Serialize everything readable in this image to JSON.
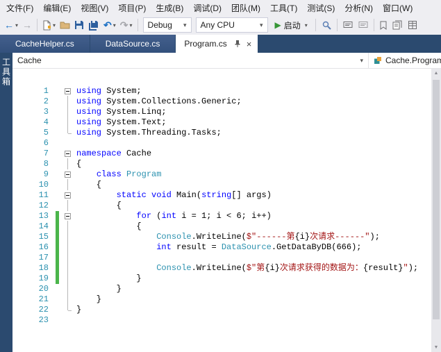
{
  "menu": {
    "items": [
      "文件(F)",
      "编辑(E)",
      "视图(V)",
      "项目(P)",
      "生成(B)",
      "调试(D)",
      "团队(M)",
      "工具(T)",
      "测试(S)",
      "分析(N)",
      "窗口(W)"
    ]
  },
  "toolbar": {
    "solution_config": "Debug",
    "platform": "Any CPU",
    "start_label": "启动"
  },
  "icons": {
    "back": "←",
    "forward": "→",
    "undo": "↶",
    "redo": "↷",
    "caret": "▾",
    "play": "▶",
    "close": "×",
    "scroll_up": "▲",
    "scroll_down": "▼"
  },
  "tabs": [
    {
      "label": "CacheHelper.cs",
      "active": false
    },
    {
      "label": "DataSource.cs",
      "active": false
    },
    {
      "label": "Program.cs",
      "active": true
    }
  ],
  "toolbox": {
    "label": "工具箱"
  },
  "breadcrumb": {
    "project": "Cache",
    "member": "Cache.Program"
  },
  "editor": {
    "language": "csharp",
    "lines": [
      {
        "n": 1,
        "fold": "minus",
        "changed": false,
        "tokens": [
          [
            "k",
            "using"
          ],
          [
            "p",
            " System;"
          ]
        ]
      },
      {
        "n": 2,
        "fold": "line",
        "changed": false,
        "tokens": [
          [
            "k",
            "using"
          ],
          [
            "p",
            " System.Collections.Generic;"
          ]
        ]
      },
      {
        "n": 3,
        "fold": "line",
        "changed": false,
        "tokens": [
          [
            "k",
            "using"
          ],
          [
            "p",
            " System.Linq;"
          ]
        ]
      },
      {
        "n": 4,
        "fold": "line",
        "changed": false,
        "tokens": [
          [
            "k",
            "using"
          ],
          [
            "p",
            " System.Text;"
          ]
        ]
      },
      {
        "n": 5,
        "fold": "end",
        "changed": false,
        "tokens": [
          [
            "k",
            "using"
          ],
          [
            "p",
            " System.Threading.Tasks;"
          ]
        ]
      },
      {
        "n": 6,
        "fold": "",
        "changed": false,
        "tokens": []
      },
      {
        "n": 7,
        "fold": "minus",
        "changed": false,
        "tokens": [
          [
            "k",
            "namespace"
          ],
          [
            "p",
            " Cache"
          ]
        ]
      },
      {
        "n": 8,
        "fold": "line",
        "changed": false,
        "tokens": [
          [
            "p",
            "{"
          ]
        ]
      },
      {
        "n": 9,
        "fold": "minus",
        "changed": false,
        "tokens": [
          [
            "p",
            "    "
          ],
          [
            "k",
            "class"
          ],
          [
            "p",
            " "
          ],
          [
            "t",
            "Program"
          ]
        ]
      },
      {
        "n": 10,
        "fold": "line",
        "changed": false,
        "tokens": [
          [
            "p",
            "    {"
          ]
        ]
      },
      {
        "n": 11,
        "fold": "minus",
        "changed": false,
        "tokens": [
          [
            "p",
            "        "
          ],
          [
            "k",
            "static"
          ],
          [
            "p",
            " "
          ],
          [
            "k",
            "void"
          ],
          [
            "p",
            " Main("
          ],
          [
            "k",
            "string"
          ],
          [
            "p",
            "[] args)"
          ]
        ]
      },
      {
        "n": 12,
        "fold": "line",
        "changed": false,
        "tokens": [
          [
            "p",
            "        {"
          ]
        ]
      },
      {
        "n": 13,
        "fold": "minus",
        "changed": true,
        "tokens": [
          [
            "p",
            "            "
          ],
          [
            "k",
            "for"
          ],
          [
            "p",
            " ("
          ],
          [
            "k",
            "int"
          ],
          [
            "p",
            " i = 1; i < 6; i++)"
          ]
        ]
      },
      {
        "n": 14,
        "fold": "line",
        "changed": true,
        "tokens": [
          [
            "p",
            "            {"
          ]
        ]
      },
      {
        "n": 15,
        "fold": "line",
        "changed": true,
        "tokens": [
          [
            "p",
            "                "
          ],
          [
            "t",
            "Console"
          ],
          [
            "p",
            ".WriteLine("
          ],
          [
            "s",
            "$\"------第"
          ],
          [
            "p",
            "{i}"
          ],
          [
            "s",
            "次请求------\""
          ],
          [
            "p",
            ");"
          ]
        ]
      },
      {
        "n": 16,
        "fold": "line",
        "changed": true,
        "tokens": [
          [
            "p",
            "                "
          ],
          [
            "k",
            "int"
          ],
          [
            "p",
            " result = "
          ],
          [
            "t",
            "DataSource"
          ],
          [
            "p",
            ".GetDataByDB(666);"
          ]
        ]
      },
      {
        "n": 17,
        "fold": "line",
        "changed": true,
        "tokens": []
      },
      {
        "n": 18,
        "fold": "line",
        "changed": true,
        "tokens": [
          [
            "p",
            "                "
          ],
          [
            "t",
            "Console"
          ],
          [
            "p",
            ".WriteLine("
          ],
          [
            "s",
            "$\"第"
          ],
          [
            "p",
            "{i}"
          ],
          [
            "s",
            "次请求获得的数据为："
          ],
          [
            "p",
            "{result}"
          ],
          [
            "s",
            "\""
          ],
          [
            "p",
            ");"
          ]
        ]
      },
      {
        "n": 19,
        "fold": "line",
        "changed": true,
        "tokens": [
          [
            "p",
            "            }"
          ]
        ]
      },
      {
        "n": 20,
        "fold": "line",
        "changed": false,
        "tokens": [
          [
            "p",
            "        }"
          ]
        ]
      },
      {
        "n": 21,
        "fold": "line",
        "changed": false,
        "tokens": [
          [
            "p",
            "    }"
          ]
        ]
      },
      {
        "n": 22,
        "fold": "end",
        "changed": false,
        "tokens": [
          [
            "p",
            "}"
          ]
        ]
      },
      {
        "n": 23,
        "fold": "",
        "changed": false,
        "tokens": []
      }
    ]
  },
  "colors": {
    "keyword": "#0000ff",
    "type": "#2b91af",
    "string": "#a31515",
    "line_number": "#2b91af",
    "change_bar": "#4bb54b",
    "tab_strip": "#2b4a6f",
    "start_green": "#379637"
  }
}
